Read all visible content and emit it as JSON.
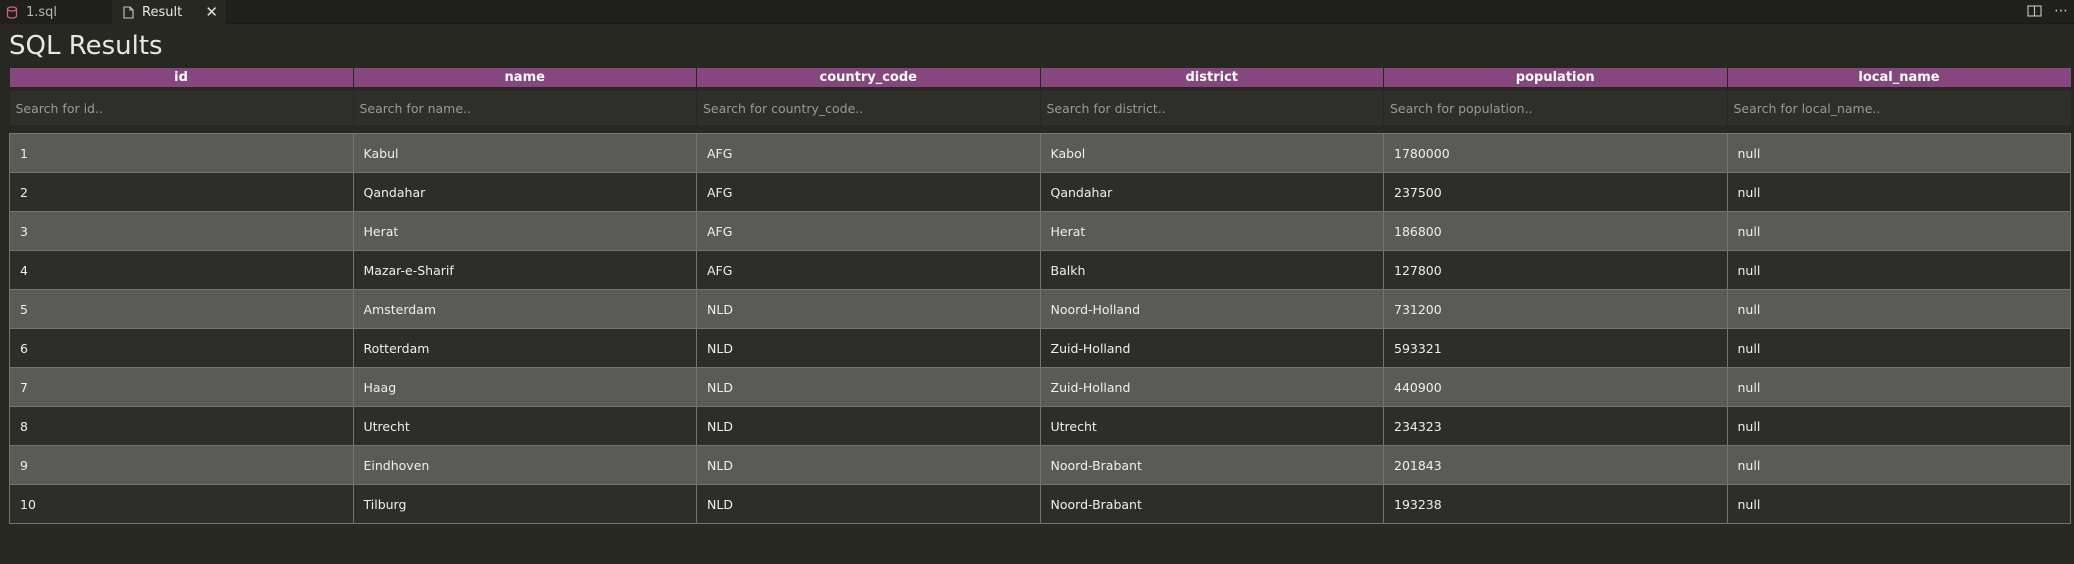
{
  "tabs": [
    {
      "label": "1.sql",
      "icon": "database-icon"
    },
    {
      "label": "Result",
      "icon": "file-icon"
    }
  ],
  "page": {
    "title": "SQL Results"
  },
  "colors": {
    "header_bg": "#86467e",
    "row_odd": "#5a5a57",
    "row_even": "#2d2e29",
    "background": "#272822"
  },
  "table": {
    "columns": [
      "id",
      "name",
      "country_code",
      "district",
      "population",
      "local_name"
    ],
    "filters": [
      "Search for id..",
      "Search for name..",
      "Search for country_code..",
      "Search for district..",
      "Search for population..",
      "Search for local_name.."
    ],
    "rows": [
      [
        "1",
        "Kabul",
        "AFG",
        "Kabol",
        "1780000",
        "null"
      ],
      [
        "2",
        "Qandahar",
        "AFG",
        "Qandahar",
        "237500",
        "null"
      ],
      [
        "3",
        "Herat",
        "AFG",
        "Herat",
        "186800",
        "null"
      ],
      [
        "4",
        "Mazar-e-Sharif",
        "AFG",
        "Balkh",
        "127800",
        "null"
      ],
      [
        "5",
        "Amsterdam",
        "NLD",
        "Noord-Holland",
        "731200",
        "null"
      ],
      [
        "6",
        "Rotterdam",
        "NLD",
        "Zuid-Holland",
        "593321",
        "null"
      ],
      [
        "7",
        "Haag",
        "NLD",
        "Zuid-Holland",
        "440900",
        "null"
      ],
      [
        "8",
        "Utrecht",
        "NLD",
        "Utrecht",
        "234323",
        "null"
      ],
      [
        "9",
        "Eindhoven",
        "NLD",
        "Noord-Brabant",
        "201843",
        "null"
      ],
      [
        "10",
        "Tilburg",
        "NLD",
        "Noord-Brabant",
        "193238",
        "null"
      ]
    ]
  }
}
